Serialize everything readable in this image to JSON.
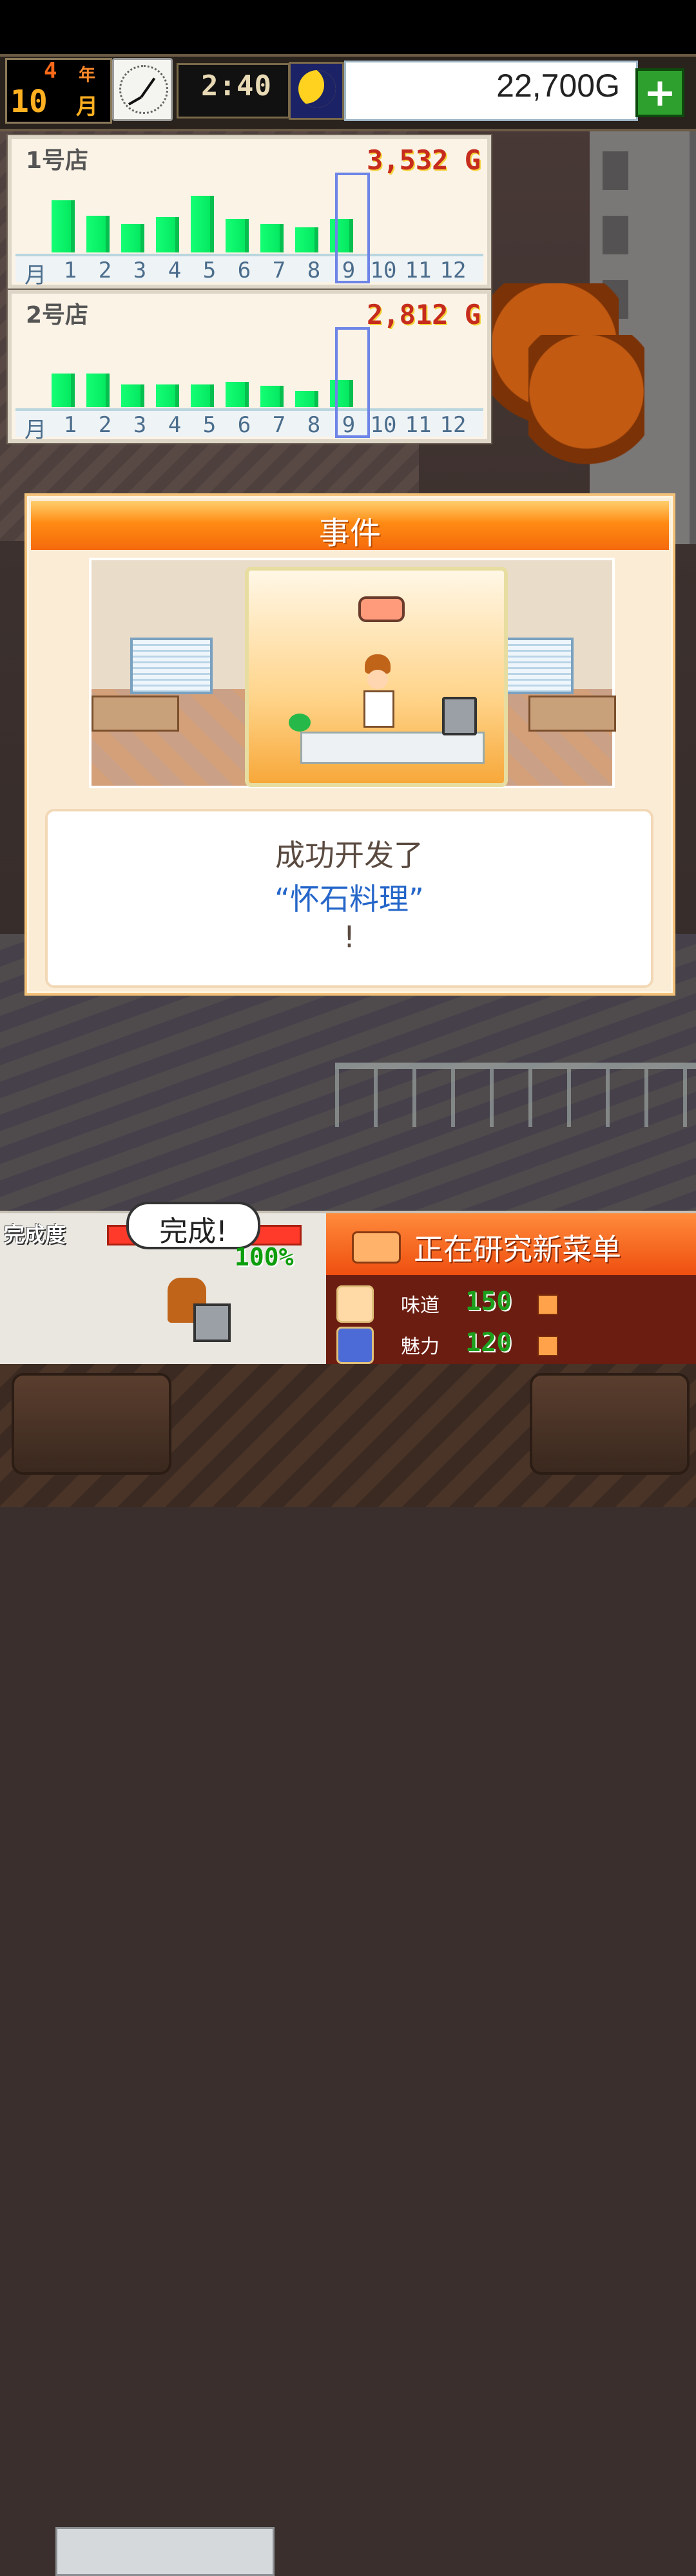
{
  "hud": {
    "year": "4",
    "year_label": "年",
    "month": "10",
    "month_label": "月",
    "time": "2:40",
    "gold": "22,700G",
    "plus_icon": "+"
  },
  "stores": [
    {
      "title": "1号店",
      "total": "3,532 G",
      "month_label": "月",
      "months": [
        "1",
        "2",
        "3",
        "4",
        "5",
        "6",
        "7",
        "8",
        "9",
        "10",
        "11",
        "12"
      ],
      "selected_month": 9,
      "bar_values": [
        74,
        52,
        40,
        50,
        80,
        47,
        40,
        35,
        47
      ]
    },
    {
      "title": "2号店",
      "total": "2,812 G",
      "month_label": "月",
      "months": [
        "1",
        "2",
        "3",
        "4",
        "5",
        "6",
        "7",
        "8",
        "9",
        "10",
        "11",
        "12"
      ],
      "selected_month": 9,
      "bar_values": [
        47,
        47,
        32,
        32,
        32,
        35,
        30,
        23,
        38
      ]
    }
  ],
  "event": {
    "title": "事件",
    "line1": "成功开发了",
    "line2": "“怀石料理”",
    "line3": "!"
  },
  "progress": {
    "label": "完成度",
    "bubble": "完成!",
    "percent": "100%"
  },
  "research": {
    "title": "正在研究新菜单",
    "stats": [
      {
        "label": "味道",
        "value": "150",
        "icon": "smiley-icon"
      },
      {
        "label": "魅力",
        "value": "120",
        "icon": "sparkle-dish-icon"
      }
    ]
  }
}
